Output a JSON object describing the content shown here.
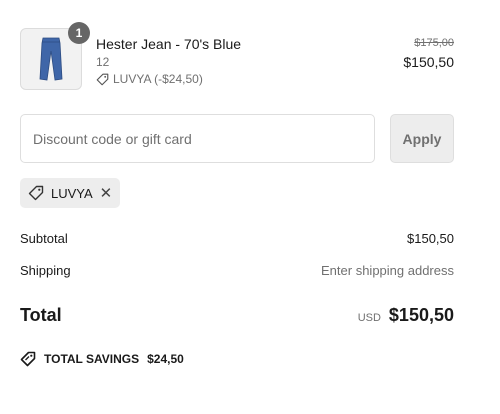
{
  "line_item": {
    "quantity": "1",
    "title": "Hester Jean - 70's Blue",
    "variant": "12",
    "discount_label": "LUVYA (-$24,50)",
    "original_price": "$175,00",
    "price": "$150,50",
    "image_icon": "jeans-icon"
  },
  "discount_form": {
    "placeholder": "Discount code or gift card",
    "value": "",
    "apply_label": "Apply"
  },
  "applied_code": {
    "code": "LUVYA",
    "tag_icon": "tag-icon",
    "remove_icon": "close-icon"
  },
  "summary": {
    "subtotal_label": "Subtotal",
    "subtotal_value": "$150,50",
    "shipping_label": "Shipping",
    "shipping_value": "Enter shipping address",
    "total_label": "Total",
    "currency": "USD",
    "total_value": "$150,50"
  },
  "savings": {
    "label": "TOTAL SAVINGS",
    "value": "$24,50",
    "icon": "discount-tag-icon"
  },
  "colors": {
    "text": "#1a1a1a",
    "muted": "#707070",
    "field_border": "#dedede",
    "button_bg": "#ededed",
    "badge_bg": "#666666"
  }
}
